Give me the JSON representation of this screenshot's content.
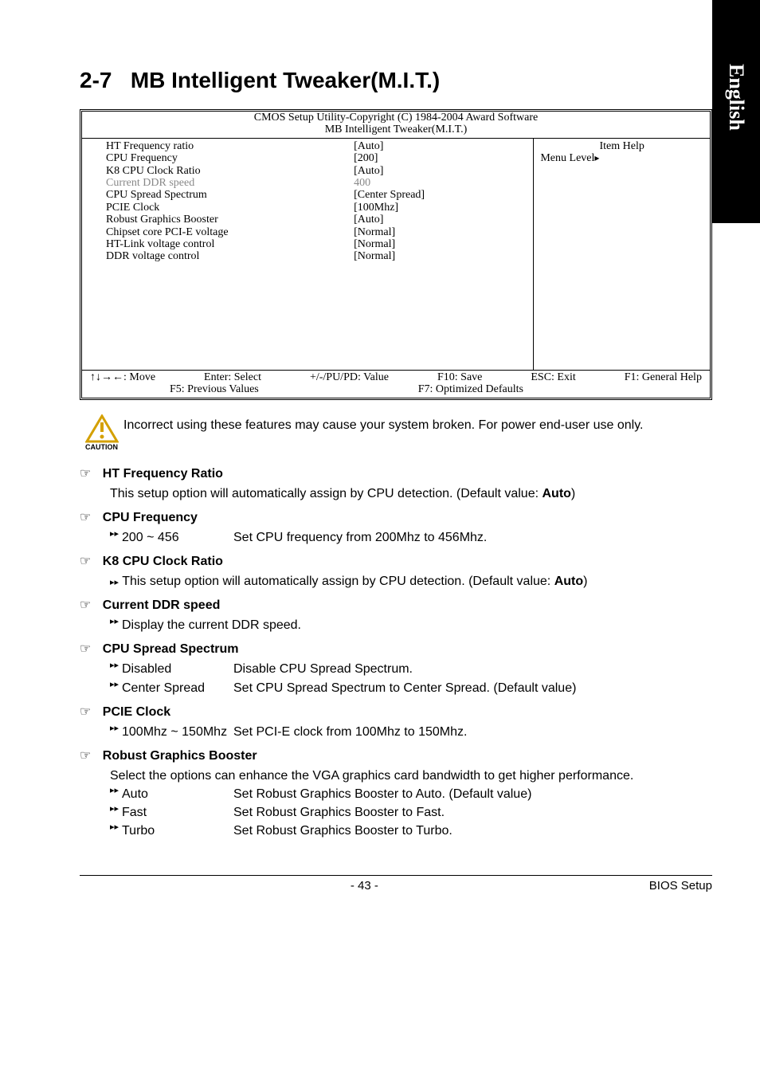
{
  "side_tab": "English",
  "section_number": "2-7",
  "section_title": "MB Intelligent Tweaker(M.I.T.)",
  "bios": {
    "header_line1": "CMOS Setup Utility-Copyright (C) 1984-2004 Award Software",
    "header_line2": "MB Intelligent Tweaker(M.I.T.)",
    "rows": [
      {
        "label": "HT Frequency ratio",
        "val": "[Auto]",
        "grey": false
      },
      {
        "label": "CPU Frequency",
        "val": "[200]",
        "grey": false
      },
      {
        "label": "K8 CPU Clock Ratio",
        "val": "[Auto]",
        "grey": false
      },
      {
        "label": "Current DDR speed",
        "val": "400",
        "grey": true
      },
      {
        "label": "CPU Spread Spectrum",
        "val": "[Center Spread]",
        "grey": false
      },
      {
        "label": "PCIE Clock",
        "val": "[100Mhz]",
        "grey": false
      },
      {
        "label": "Robust Graphics Booster",
        "val": "[Auto]",
        "grey": false
      },
      {
        "label": "Chipset core PCI-E voltage",
        "val": "[Normal]",
        "grey": false
      },
      {
        "label": "HT-Link voltage control",
        "val": "[Normal]",
        "grey": false
      },
      {
        "label": "DDR voltage control",
        "val": "[Normal]",
        "grey": false
      }
    ],
    "right": {
      "item_help": "Item Help",
      "menu_level": "Menu Level"
    },
    "footer": {
      "r1": [
        "↑↓→←: Move",
        "Enter: Select",
        "+/-/PU/PD: Value",
        "F10: Save",
        "ESC: Exit",
        "F1: General Help"
      ],
      "r2": [
        "F5: Previous Values",
        "F7: Optimized Defaults"
      ]
    }
  },
  "caution": {
    "label": "CAUTION",
    "text": "Incorrect using these features may cause your system broken. For power end-user use only."
  },
  "options": [
    {
      "title": "HT Frequency Ratio",
      "plain": "This setup option will automatically assign by CPU detection. (Default value: ",
      "plain_bold": "Auto",
      "plain_after": ")"
    },
    {
      "title": "CPU Frequency",
      "lines": [
        {
          "key": "200 ~ 456",
          "desc": "Set CPU frequency from 200Mhz to 456Mhz."
        }
      ]
    },
    {
      "title": "K8 CPU Clock Ratio",
      "marker_plain": "This setup option will automatically assign by CPU detection. (Default value: ",
      "marker_plain_bold": "Auto",
      "marker_plain_after": ")"
    },
    {
      "title": "Current DDR speed",
      "lines": [
        {
          "key": "",
          "desc": "Display the current DDR speed.",
          "nokey": true
        }
      ]
    },
    {
      "title": "CPU Spread Spectrum",
      "lines": [
        {
          "key": "Disabled",
          "desc": "Disable CPU Spread Spectrum."
        },
        {
          "key": "Center Spread",
          "desc": "Set CPU Spread Spectrum to Center Spread. (Default value)"
        }
      ]
    },
    {
      "title": "PCIE Clock",
      "lines": [
        {
          "key": "100Mhz ~ 150Mhz",
          "desc": "Set PCI-E clock from 100Mhz to 150Mhz."
        }
      ]
    },
    {
      "title": "Robust Graphics Booster",
      "plain_nomarker": "Select the options can enhance the VGA graphics card bandwidth to get higher performance.",
      "lines": [
        {
          "key": "Auto",
          "desc": "Set Robust Graphics Booster to Auto. (Default value)"
        },
        {
          "key": "Fast",
          "desc": "Set Robust Graphics Booster to Fast."
        },
        {
          "key": "Turbo",
          "desc": "Set Robust Graphics Booster to Turbo."
        }
      ]
    }
  ],
  "footer": {
    "page": "- 43 -",
    "section": "BIOS Setup"
  }
}
